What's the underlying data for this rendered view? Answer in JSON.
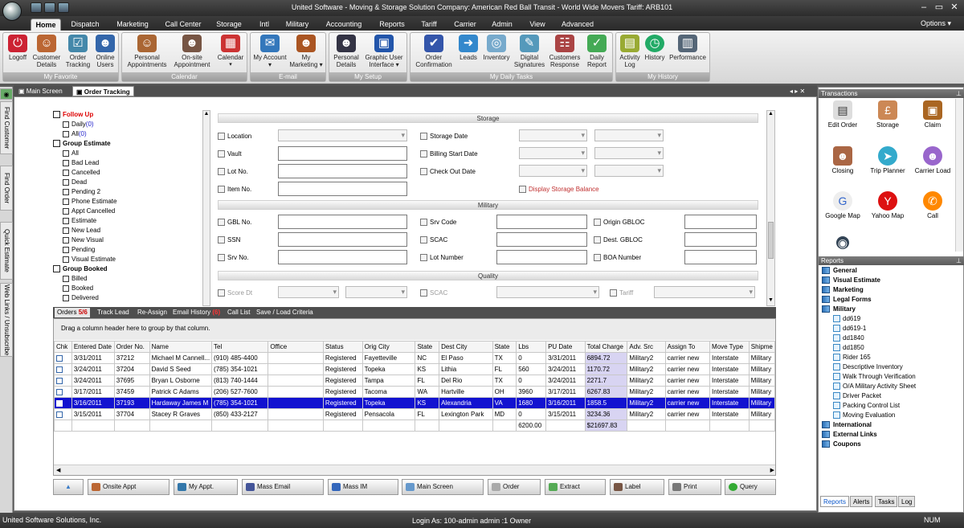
{
  "window": {
    "title": "United Software - Moving & Storage Solution   Company: American Red Ball Transit - World Wide Movers  Tariff: ARB101"
  },
  "menu": {
    "tabs": [
      "Home",
      "Dispatch",
      "Marketing",
      "Call Center",
      "Storage",
      "Intl",
      "Military",
      "Accounting",
      "Reports",
      "Tariff",
      "Carrier",
      "Admin",
      "View",
      "Advanced"
    ],
    "options": "Options ▾"
  },
  "ribbon": {
    "groups": [
      {
        "label": "My Favorite",
        "buttons": [
          "Logoff",
          "Customer Details",
          "Order Tracking",
          "Online Users"
        ]
      },
      {
        "label": "Calendar",
        "buttons": [
          "Personal Appointments",
          "On-site Appointment",
          "Calendar"
        ]
      },
      {
        "label": "E-mail",
        "buttons": [
          "My Account ▾",
          "My Marketing ▾"
        ]
      },
      {
        "label": "My Setup",
        "buttons": [
          "Personal Details",
          "Graphic User Interface ▾"
        ]
      },
      {
        "label": "My Daily Tasks",
        "buttons": [
          "Order Confirmation",
          "Leads",
          "Inventory",
          "Digital Signatures",
          "Customers Response",
          "Daily Report"
        ]
      },
      {
        "label": "My History",
        "buttons": [
          "Activity Log",
          "History",
          "Performance"
        ]
      }
    ]
  },
  "left_tabs": [
    "Find Customer",
    "Find Order",
    "Quick Estimate",
    "Web Links / Unsubscribe"
  ],
  "doc_tabs": [
    "Main Screen",
    "Order Tracking"
  ],
  "tree": [
    {
      "label": "Follow Up",
      "lvl": 0,
      "red": true
    },
    {
      "label": "Daily",
      "count": "(0)",
      "lvl": 1
    },
    {
      "label": "All",
      "count": "(0)",
      "lvl": 1
    },
    {
      "label": "Group Estimate",
      "lvl": 0
    },
    {
      "label": "All",
      "lvl": 1
    },
    {
      "label": "Bad Lead",
      "lvl": 1
    },
    {
      "label": "Cancelled",
      "lvl": 1
    },
    {
      "label": "Dead",
      "lvl": 1
    },
    {
      "label": "Pending 2",
      "lvl": 1
    },
    {
      "label": "Phone Estimate",
      "lvl": 1
    },
    {
      "label": "Appt Cancelled",
      "lvl": 1
    },
    {
      "label": "Estimate",
      "lvl": 1
    },
    {
      "label": "New Lead",
      "lvl": 1
    },
    {
      "label": "New Visual",
      "lvl": 1
    },
    {
      "label": "Pending",
      "lvl": 1
    },
    {
      "label": "Visual Estimate",
      "lvl": 1
    },
    {
      "label": "Group Booked",
      "lvl": 0
    },
    {
      "label": "Billed",
      "lvl": 1
    },
    {
      "label": "Booked",
      "lvl": 1
    },
    {
      "label": "Delivered",
      "lvl": 1
    }
  ],
  "filters": {
    "storage_header": "Storage",
    "military_header": "Military",
    "quality_header": "Quality",
    "location": "Location",
    "vault": "Vault",
    "lot_no": "Lot No.",
    "item_no": "Item No.",
    "storage_date": "Storage Date",
    "billing_start_date": "Billing Start Date",
    "check_out_date": "Check Out Date",
    "display_storage_balance": "Display Storage Balance",
    "gbl_no": "GBL No.",
    "ssn": "SSN",
    "srv_no": "Srv No.",
    "srv_code": "Srv Code",
    "scac": "SCAC",
    "lot_number": "Lot Number",
    "origin_gbloc": "Origin GBLOC",
    "dest_gbloc": "Dest. GBLOC",
    "boa_number": "BOA Number",
    "score_dt": "Score Dt",
    "q_scac": "SCAC",
    "tariff": "Tariff"
  },
  "grid": {
    "tabs": [
      "Orders",
      "Track Lead",
      "Re-Assign",
      "Email History",
      "Call List",
      "Save / Load Criteria"
    ],
    "orders_count": "5/6",
    "email_count": "(6)",
    "group_hint": "Drag a column header here to group by that column.",
    "columns": [
      "Chk",
      "Entered Date",
      "Order No.",
      "Name",
      "Tel",
      "Office",
      "Status",
      "Orig City",
      "State",
      "Dest City",
      "State",
      "Lbs",
      "PU Date",
      "Total Charge",
      "Adv. Src",
      "Assign To",
      "Move Type",
      "Shipme"
    ],
    "rows": [
      [
        "",
        "3/31/2011",
        "37212",
        "Michael M Cannell...",
        "(910) 485-4400",
        "",
        "Registered",
        "Fayetteville",
        "NC",
        "El Paso",
        "TX",
        "0",
        "3/31/2011",
        "6894.72",
        "Military2",
        "carrier new",
        "Interstate",
        "Military"
      ],
      [
        "",
        "3/24/2011",
        "37204",
        "David S Seed",
        "(785) 354-1021",
        "",
        "Registered",
        "Topeka",
        "KS",
        "Lithia",
        "FL",
        "560",
        "3/24/2011",
        "1170.72",
        "Military2",
        "carrier new",
        "Interstate",
        "Military"
      ],
      [
        "",
        "3/24/2011",
        "37695",
        "Bryan L Osborne",
        "(813) 740-1444",
        "",
        "Registered",
        "Tampa",
        "FL",
        "Del Rio",
        "TX",
        "0",
        "3/24/2011",
        "2271.7",
        "Military2",
        "carrier new",
        "Interstate",
        "Military"
      ],
      [
        "",
        "3/17/2011",
        "37459",
        "Patrick C Adams",
        "(206) 527-7600",
        "",
        "Registered",
        "Tacoma",
        "WA",
        "Hartville",
        "OH",
        "3960",
        "3/17/2011",
        "6267.83",
        "Military2",
        "carrier new",
        "Interstate",
        "Military"
      ],
      [
        "",
        "3/16/2011",
        "37193",
        "Hardaway James M",
        "(785) 354-1021",
        "",
        "Registered",
        "Topeka",
        "KS",
        "Alexandria",
        "VA",
        "1680",
        "3/16/2011",
        "1858.5",
        "Military2",
        "carrier new",
        "Interstate",
        "Military"
      ],
      [
        "",
        "3/15/2011",
        "37704",
        "Stacey R Graves",
        "(850) 433-2127",
        "",
        "Registered",
        "Pensacola",
        "FL",
        "Lexington Park",
        "MD",
        "0",
        "3/15/2011",
        "3234.36",
        "Military2",
        "carrier new",
        "Interstate",
        "Military"
      ]
    ],
    "selected_row": 4,
    "totals": {
      "lbs": "6200.00",
      "charge": "$21697.83"
    }
  },
  "buttons": [
    "",
    "Onsite Appt",
    "My Appt.",
    "Mass Email",
    "Mass IM",
    "Main Screen",
    "Order",
    "Extract",
    "Label",
    "Print",
    "Query"
  ],
  "transactions": {
    "header": "Transactions",
    "items": [
      "Edit Order",
      "Storage",
      "Claim",
      "Closing",
      "Trip Planner",
      "Carrier Load",
      "Google Map",
      "Yahoo Map",
      "Call"
    ]
  },
  "reports": {
    "header": "Reports",
    "top": [
      "General",
      "Visual Estimate",
      "Marketing",
      "Legal Forms",
      "Military"
    ],
    "military_items": [
      "dd619",
      "dd619-1",
      "dd1840",
      "dd1850",
      "Rider 165",
      "Descriptive Inventory",
      "Walk Through Verification",
      "O/A Military Activity Sheet",
      "Driver Packet",
      "Packing Control List",
      "Moving Evaluation"
    ],
    "bottom": [
      "International",
      "External Links",
      "Coupons"
    ],
    "tabs": [
      "Reports",
      "Alerts",
      "Tasks",
      "Log"
    ]
  },
  "status": {
    "company": "United Software Solutions, Inc.",
    "login": "Login As: 100-admin admin :1  Owner",
    "num": "NUM"
  }
}
